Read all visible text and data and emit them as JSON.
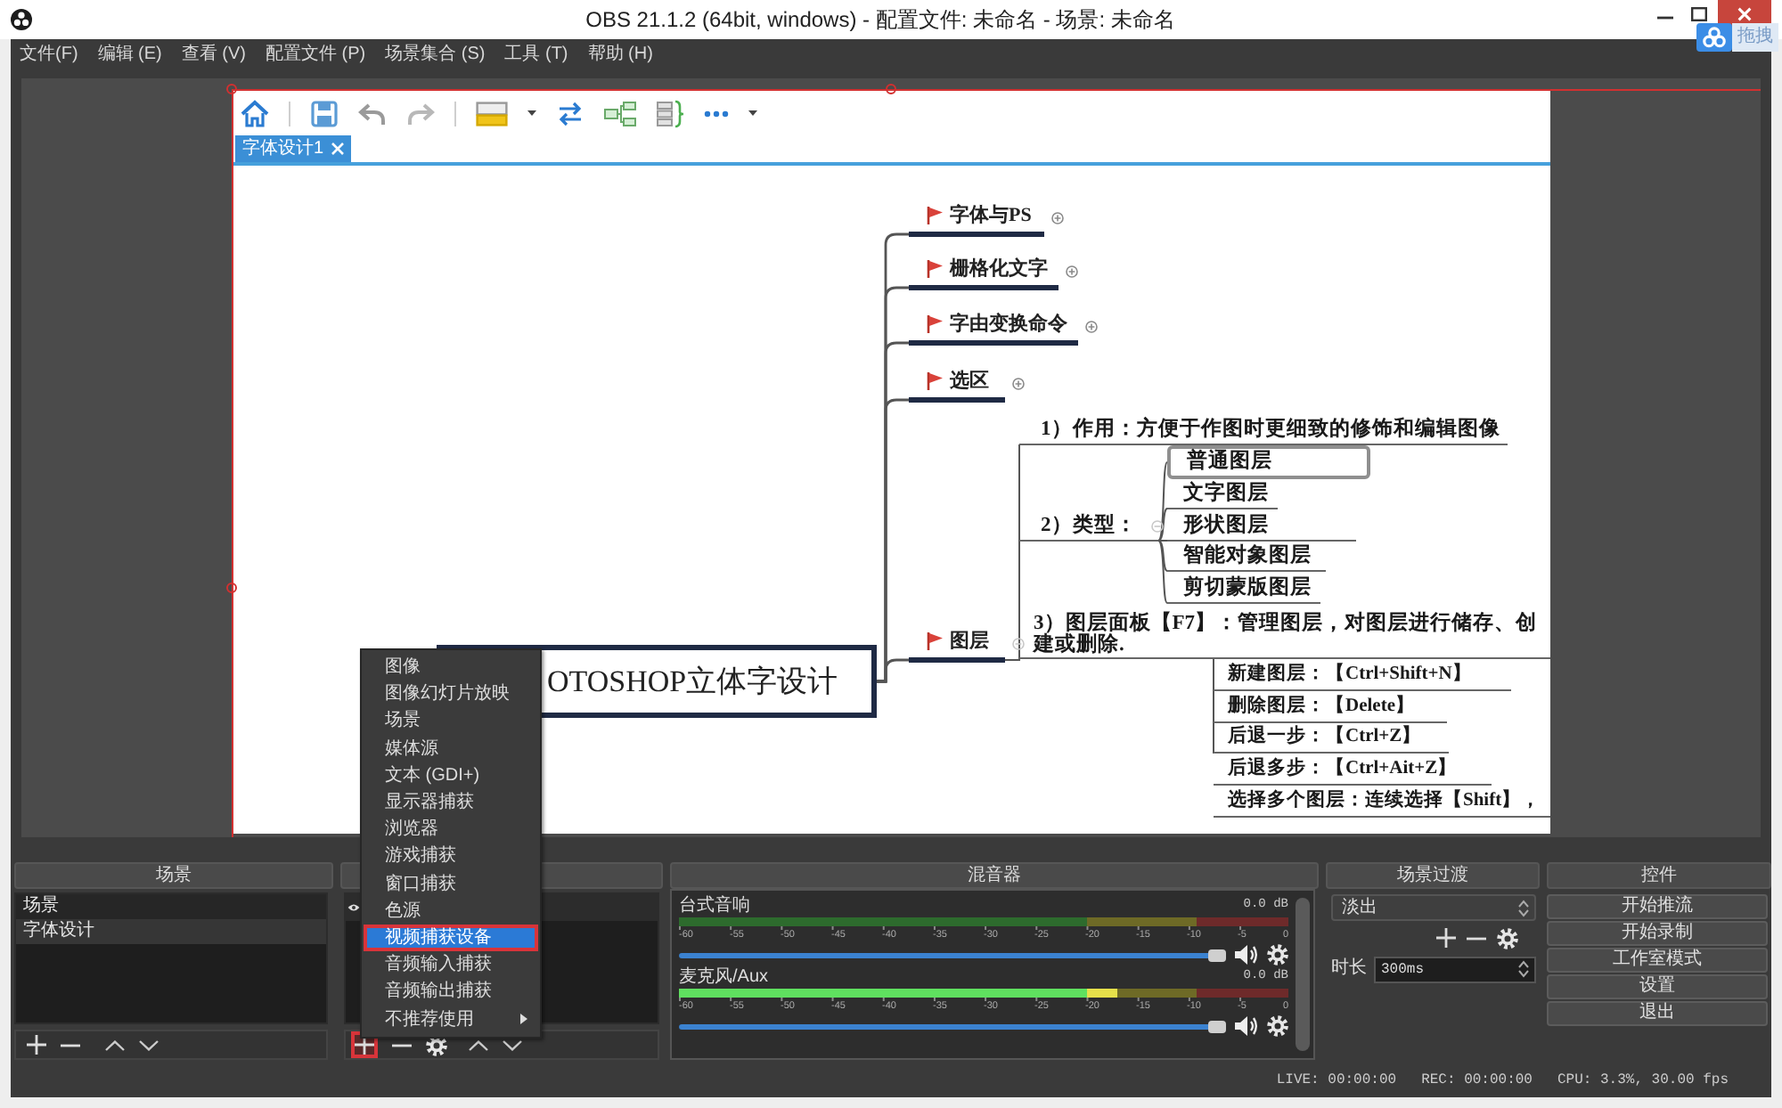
{
  "window": {
    "title": "OBS 21.1.2 (64bit, windows) - 配置文件: 未命名 - 场景: 未命名"
  },
  "floating_widget": {
    "label": "拖拽"
  },
  "menu": [
    "文件(F)",
    "编辑 (E)",
    "查看 (V)",
    "配置文件 (P)",
    "场景集合 (S)",
    "工具 (T)",
    "帮助 (H)"
  ],
  "preview": {
    "source_selected": true,
    "captured_window": {
      "tabs": [
        {
          "label": "字体设计1",
          "selected": true
        }
      ],
      "mind_map": {
        "central_topic": "OTOSHOP立体字设计",
        "branches": [
          {
            "label": "字体与PS",
            "collapsed": true
          },
          {
            "label": "栅格化文字",
            "collapsed": true
          },
          {
            "label": "字由变换命令",
            "collapsed": true
          },
          {
            "label": "选区",
            "collapsed": true
          },
          {
            "label": "图层",
            "collapsed": false,
            "children": [
              {
                "label": "1）作用：方便于作图时更细致的修饰和编辑图像"
              },
              {
                "label": "2）类型：",
                "collapsed": false,
                "children": [
                  {
                    "label": "普通图层",
                    "selected": true
                  },
                  {
                    "label": "文字图层",
                    "selected": false
                  },
                  {
                    "label": "形状图层",
                    "selected": false
                  },
                  {
                    "label": "智能对象图层",
                    "selected": false
                  },
                  {
                    "label": "剪切蒙版图层",
                    "selected": false
                  }
                ]
              },
              {
                "label": "3）图层面板【F7】：管理图层，对图层进行储存、创建或删除.",
                "children": [
                  {
                    "label": "新建图层：【Ctrl+Shift+N】"
                  },
                  {
                    "label": "删除图层：【Delete】"
                  },
                  {
                    "label": "后退一步：【Ctrl+Z】"
                  },
                  {
                    "label": "后退多步：【Ctrl+Ait+Z】"
                  },
                  {
                    "label": "选择多个图层：连续选择【Shift】，"
                  }
                ]
              }
            ]
          }
        ]
      }
    }
  },
  "context_menu": {
    "items": [
      {
        "label": "图像",
        "selected": false,
        "marked": false,
        "has_submenu": false
      },
      {
        "label": "图像幻灯片放映",
        "selected": false,
        "marked": false,
        "has_submenu": false
      },
      {
        "label": "场景",
        "selected": false,
        "marked": false,
        "has_submenu": false
      },
      {
        "label": "媒体源",
        "selected": false,
        "marked": false,
        "has_submenu": false
      },
      {
        "label": "文本 (GDI+)",
        "selected": false,
        "marked": false,
        "has_submenu": false
      },
      {
        "label": "显示器捕获",
        "selected": false,
        "marked": false,
        "has_submenu": false
      },
      {
        "label": "浏览器",
        "selected": false,
        "marked": false,
        "has_submenu": false
      },
      {
        "label": "游戏捕获",
        "selected": false,
        "marked": false,
        "has_submenu": false
      },
      {
        "label": "窗口捕获",
        "selected": false,
        "marked": false,
        "has_submenu": false
      },
      {
        "label": "色源",
        "selected": false,
        "marked": false,
        "has_submenu": false
      },
      {
        "label": "视频捕获设备",
        "selected": true,
        "marked": true,
        "has_submenu": false
      },
      {
        "label": "音频输入捕获",
        "selected": false,
        "marked": false,
        "has_submenu": false
      },
      {
        "label": "音频输出捕获",
        "selected": false,
        "marked": false,
        "has_submenu": false
      },
      {
        "label": "不推荐使用",
        "selected": false,
        "marked": false,
        "has_submenu": true
      }
    ]
  },
  "scenes": {
    "title": "场景",
    "items": [
      {
        "label": "场景",
        "selected": false
      },
      {
        "label": "字体设计",
        "selected": true
      }
    ]
  },
  "sources": {
    "items": [
      {
        "visible": true
      }
    ],
    "add_button_marked": true
  },
  "mixer": {
    "title": "混音器",
    "channels": [
      {
        "name": "台式音响",
        "reading": "0.0 dB",
        "fader": {
          "level": 1
        },
        "scale": [
          "-60",
          "-55",
          "-50",
          "-45",
          "-40",
          "-35",
          "-30",
          "-25",
          "-20",
          "-15",
          "-10",
          "-5",
          "0"
        ]
      },
      {
        "name": "麦克风/Aux",
        "reading": "0.0 dB",
        "meter": {
          "level": 0.72
        },
        "fader": {
          "level": 1
        },
        "scale": [
          "-60",
          "-55",
          "-50",
          "-45",
          "-40",
          "-35",
          "-30",
          "-25",
          "-20",
          "-15",
          "-10",
          "-5",
          "0"
        ]
      }
    ]
  },
  "transitions": {
    "title": "场景过渡",
    "value": "淡出",
    "duration_label": "时长",
    "duration": "300ms"
  },
  "controls": {
    "title": "控件",
    "buttons": [
      "开始推流",
      "开始录制",
      "工作室模式",
      "设置",
      "退出"
    ]
  },
  "status_bar": {
    "live": "LIVE: 00:00:00",
    "rec": "REC: 00:00:00",
    "cpu": "CPU: 3.3%, 30.00 fps"
  }
}
